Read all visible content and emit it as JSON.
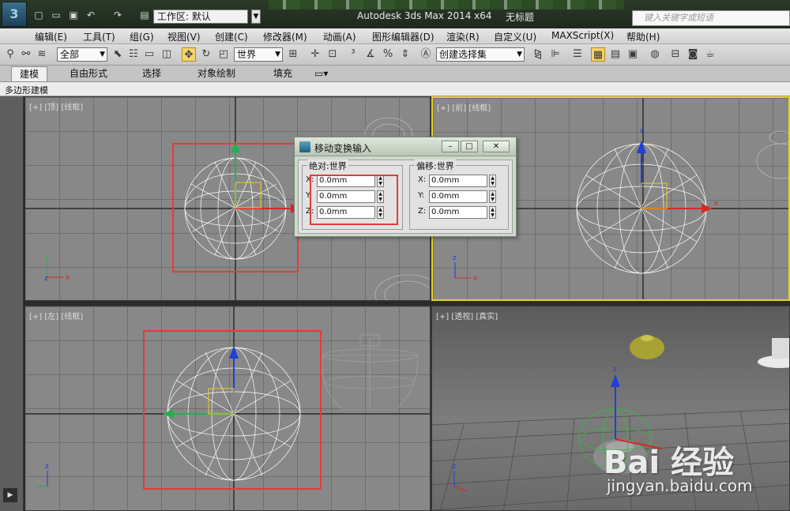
{
  "titlebar": {
    "app_logo": "3",
    "workspace_label": "工作区: 默认",
    "app_title": "Autodesk 3ds Max  2014 x64",
    "doc_title": "无标题",
    "search_placeholder": "键入关键字或短语",
    "qat_icons": [
      "new-file-icon",
      "open-folder-icon",
      "save-icon",
      "undo-icon",
      "redo-icon",
      "project-folder-icon"
    ]
  },
  "menubar": {
    "items": [
      "编辑(E)",
      "工具(T)",
      "组(G)",
      "视图(V)",
      "创建(C)",
      "修改器(M)",
      "动画(A)",
      "图形编辑器(D)",
      "渲染(R)",
      "自定义(U)",
      "MAXScript(X)",
      "帮助(H)"
    ]
  },
  "toolbar": {
    "selection_filter": "全部",
    "ref_coord": "世界",
    "named_selection": "创建选择集",
    "active_tool": "select-and-move-icon"
  },
  "ribbon": {
    "tabs": [
      "建模",
      "自由形式",
      "选择",
      "对象绘制",
      "填充"
    ],
    "active_tab": "建模",
    "sub_label": "多边形建模"
  },
  "viewports": {
    "top": {
      "label": "[+] [顶] [线框]"
    },
    "front": {
      "label": "[+] [前] [线框]"
    },
    "left": {
      "label": "[+] [左] [线框]"
    },
    "perspective": {
      "label": "[+] [透视] [真实]"
    },
    "active": "front"
  },
  "dialog": {
    "title": "移动变换输入",
    "absolute": {
      "title": "绝对:世界",
      "x": "0.0mm",
      "y": "0.0mm",
      "z": "0.0mm"
    },
    "offset": {
      "title": "偏移:世界",
      "x": "0.0mm",
      "y": "0.0mm",
      "z": "0.0mm"
    },
    "labels": {
      "x": "X:",
      "y": "Y:",
      "z": "Z:"
    }
  },
  "watermark": {
    "logo": "Bai 经验",
    "url": "jingyan.baidu.com"
  },
  "colors": {
    "highlight": "#e53b3b",
    "active_viewport": "#e8d21f",
    "axis_x": "#d62828",
    "axis_y": "#22b14c",
    "axis_z": "#1f3fd8"
  }
}
